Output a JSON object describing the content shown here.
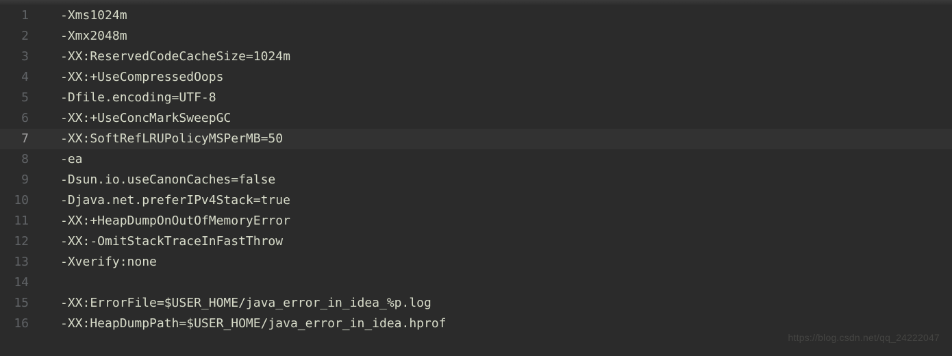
{
  "lines": [
    {
      "n": "1",
      "text": "-Xms1024m"
    },
    {
      "n": "2",
      "text": "-Xmx2048m"
    },
    {
      "n": "3",
      "text": "-XX:ReservedCodeCacheSize=1024m"
    },
    {
      "n": "4",
      "text": "-XX:+UseCompressedOops"
    },
    {
      "n": "5",
      "text": "-Dfile.encoding=UTF-8"
    },
    {
      "n": "6",
      "text": "-XX:+UseConcMarkSweepGC"
    },
    {
      "n": "7",
      "text": "-XX:SoftRefLRUPolicyMSPerMB=50"
    },
    {
      "n": "8",
      "text": "-ea"
    },
    {
      "n": "9",
      "text": "-Dsun.io.useCanonCaches=false"
    },
    {
      "n": "10",
      "text": "-Djava.net.preferIPv4Stack=true"
    },
    {
      "n": "11",
      "text": "-XX:+HeapDumpOnOutOfMemoryError"
    },
    {
      "n": "12",
      "text": "-XX:-OmitStackTraceInFastThrow"
    },
    {
      "n": "13",
      "text": "-Xverify:none"
    },
    {
      "n": "14",
      "text": ""
    },
    {
      "n": "15",
      "text": "-XX:ErrorFile=$USER_HOME/java_error_in_idea_%p.log"
    },
    {
      "n": "16",
      "text": "-XX:HeapDumpPath=$USER_HOME/java_error_in_idea.hprof"
    }
  ],
  "current_line": 7,
  "watermark": "https://blog.csdn.net/qq_24222047"
}
